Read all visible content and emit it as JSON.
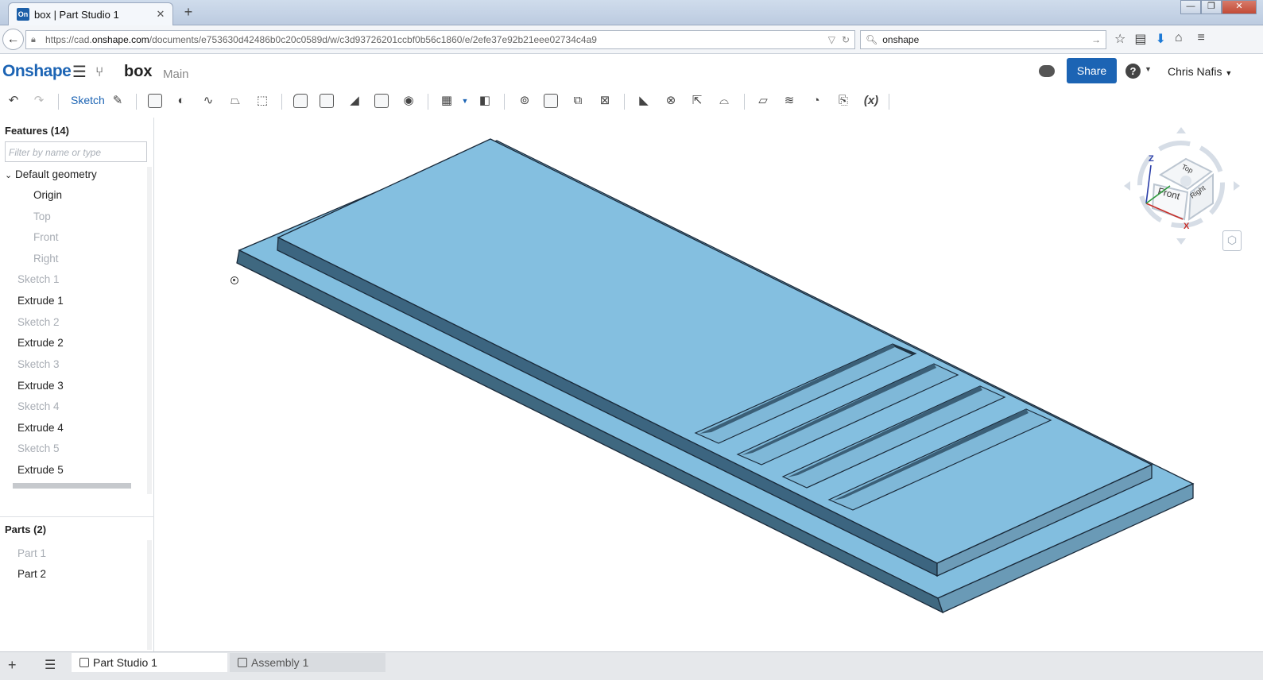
{
  "browser": {
    "tab_title": "box | Part Studio 1",
    "favicon_text": "On",
    "url_prefix": "https://cad.",
    "url_domain": "onshape.com",
    "url_rest": "/documents/e753630d42486b0c20c0589d/w/c3d93726201ccbf0b56c1860/e/2efe37e92b21eee02734c4a9",
    "search_value": "onshape"
  },
  "app": {
    "logo": "Onshape",
    "document_name": "box",
    "workspace": "Main",
    "share_label": "Share",
    "help_label": "?",
    "user_name": "Chris Nafis",
    "accent_color": "#1c64b4"
  },
  "toolbar": {
    "sketch_label": "Sketch",
    "variable_label": "(x)"
  },
  "features": {
    "header": "Features (14)",
    "filter_placeholder": "Filter by name or type",
    "group_label": "Default geometry",
    "items": [
      {
        "label": "Origin",
        "enabled": true
      },
      {
        "label": "Top",
        "enabled": false
      },
      {
        "label": "Front",
        "enabled": false
      },
      {
        "label": "Right",
        "enabled": false
      },
      {
        "label": "Sketch 1",
        "enabled": false
      },
      {
        "label": "Extrude 1",
        "enabled": true
      },
      {
        "label": "Sketch 2",
        "enabled": false
      },
      {
        "label": "Extrude 2",
        "enabled": true
      },
      {
        "label": "Sketch 3",
        "enabled": false
      },
      {
        "label": "Extrude 3",
        "enabled": true
      },
      {
        "label": "Sketch 4",
        "enabled": false
      },
      {
        "label": "Extrude 4",
        "enabled": true
      },
      {
        "label": "Sketch 5",
        "enabled": false
      },
      {
        "label": "Extrude 5",
        "enabled": true
      }
    ]
  },
  "parts": {
    "header": "Parts (2)",
    "items": [
      {
        "label": "Part 1",
        "enabled": false
      },
      {
        "label": "Part 2",
        "enabled": true
      }
    ]
  },
  "viewcube": {
    "top": "Top",
    "front": "Front",
    "right": "Right",
    "axis_z": "Z",
    "axis_x": "X"
  },
  "bottom_tabs": {
    "active": "Part Studio 1",
    "inactive": "Assembly 1"
  }
}
